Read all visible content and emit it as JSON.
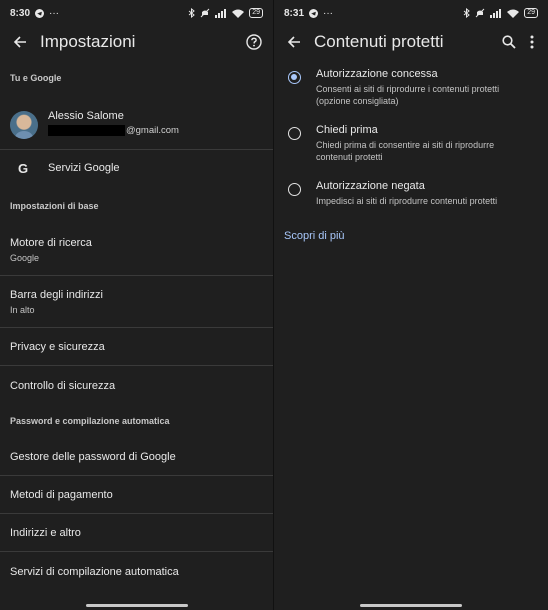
{
  "left": {
    "status": {
      "time": "8:30",
      "battery": "29"
    },
    "appbar": {
      "title": "Impostazioni"
    },
    "section_tu": "Tu e Google",
    "account": {
      "name": "Alessio Salome",
      "email_suffix": "@gmail.com"
    },
    "google_services": {
      "icon_letter": "G",
      "label": "Servizi Google"
    },
    "section_base": "Impostazioni di base",
    "search_engine": {
      "label": "Motore di ricerca",
      "value": "Google"
    },
    "address_bar": {
      "label": "Barra degli indirizzi",
      "value": "In alto"
    },
    "privacy": {
      "label": "Privacy e sicurezza"
    },
    "safety_check": {
      "label": "Controllo di sicurezza"
    },
    "section_pass": "Password e compilazione automatica",
    "password_manager": {
      "label": "Gestore delle password di Google"
    },
    "payment_methods": {
      "label": "Metodi di pagamento"
    },
    "addresses": {
      "label": "Indirizzi e altro"
    },
    "autofill_services": {
      "label": "Servizi di compilazione automatica"
    }
  },
  "right": {
    "status": {
      "time": "8:31",
      "battery": "29"
    },
    "appbar": {
      "title": "Contenuti protetti"
    },
    "options": [
      {
        "title": "Autorizzazione concessa",
        "desc": "Consenti ai siti di riprodurre i contenuti protetti (opzione consigliata)",
        "selected": true
      },
      {
        "title": "Chiedi prima",
        "desc": "Chiedi prima di consentire ai siti di riprodurre contenuti protetti",
        "selected": false
      },
      {
        "title": "Autorizzazione negata",
        "desc": "Impedisci ai siti di riprodurre contenuti protetti",
        "selected": false
      }
    ],
    "learn_more": "Scopri di più"
  },
  "colors": {
    "background": "#1f1f1f",
    "accent": "#a8c7fa",
    "divider": "#3a3a3a"
  }
}
